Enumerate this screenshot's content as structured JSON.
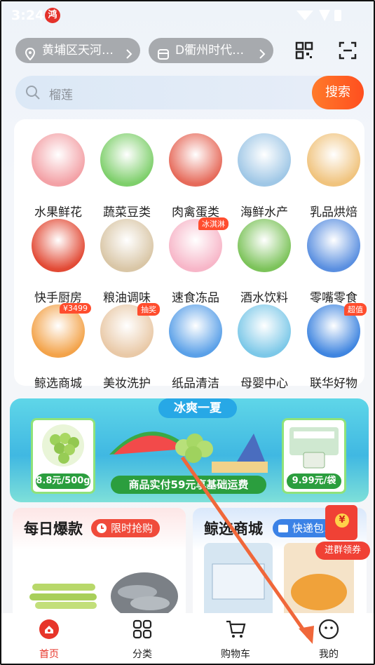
{
  "status_bar": {
    "time": "3:24"
  },
  "location": {
    "district": "黄埔区天河…",
    "store": "D衢州时代…"
  },
  "search": {
    "placeholder": "榴莲",
    "button": "搜索"
  },
  "categories": [
    {
      "label": "水果鲜花",
      "icon": "watermelon-icon",
      "color": "#f3a1a6"
    },
    {
      "label": "蔬菜豆类",
      "icon": "vegetable-icon",
      "color": "#7ecf6b"
    },
    {
      "label": "肉禽蛋类",
      "icon": "meat-icon",
      "color": "#e66a5a"
    },
    {
      "label": "海鲜水产",
      "icon": "fish-icon",
      "color": "#9fc7e6"
    },
    {
      "label": "乳品烘焙",
      "icon": "milk-icon",
      "color": "#f0c37d"
    },
    {
      "label": "快手厨房",
      "icon": "crayfish-icon",
      "color": "#e24a35"
    },
    {
      "label": "粮油调味",
      "icon": "rice-bag-icon",
      "color": "#d9c6a6"
    },
    {
      "label": "速食冻品",
      "icon": "icecream-icon",
      "color": "#f7b6c8",
      "tag": "冰淇淋"
    },
    {
      "label": "酒水饮料",
      "icon": "bottle-icon",
      "color": "#7cc35a"
    },
    {
      "label": "零嘴零食",
      "icon": "snack-icon",
      "color": "#5a8fe0"
    },
    {
      "label": "鲸选商城",
      "icon": "camera-icon",
      "color": "#f3a34a",
      "tag": "¥3499"
    },
    {
      "label": "美妆洗护",
      "icon": "cosmetics-icon",
      "color": "#e9c9a7",
      "tag": "抽奖"
    },
    {
      "label": "纸品清洁",
      "icon": "tissue-icon",
      "color": "#5aa0e8"
    },
    {
      "label": "母婴中心",
      "icon": "formula-icon",
      "color": "#7cc8e8"
    },
    {
      "label": "联华好物",
      "icon": "gift-box-icon",
      "color": "#3f85e0",
      "tag": "超值"
    }
  ],
  "banner": {
    "ribbon": "冰爽一夏",
    "left_price": "8.8元/500g",
    "right_price": "9.99元/袋",
    "slogan": "商品实付59元享基础运费"
  },
  "panels": [
    {
      "title": "每日爆款",
      "badge": "限时抢购"
    },
    {
      "title": "鲸选商城",
      "badge": "快递包…"
    }
  ],
  "coupon": {
    "text": "进群领券"
  },
  "tabs": [
    {
      "label": "首页",
      "active": true
    },
    {
      "label": "分类",
      "active": false
    },
    {
      "label": "购物车",
      "active": false
    },
    {
      "label": "我的",
      "active": false
    }
  ],
  "colors": {
    "accent": "#e7352a",
    "search_button": "#ff5a22",
    "annotation_arrow": "#f0673a"
  }
}
